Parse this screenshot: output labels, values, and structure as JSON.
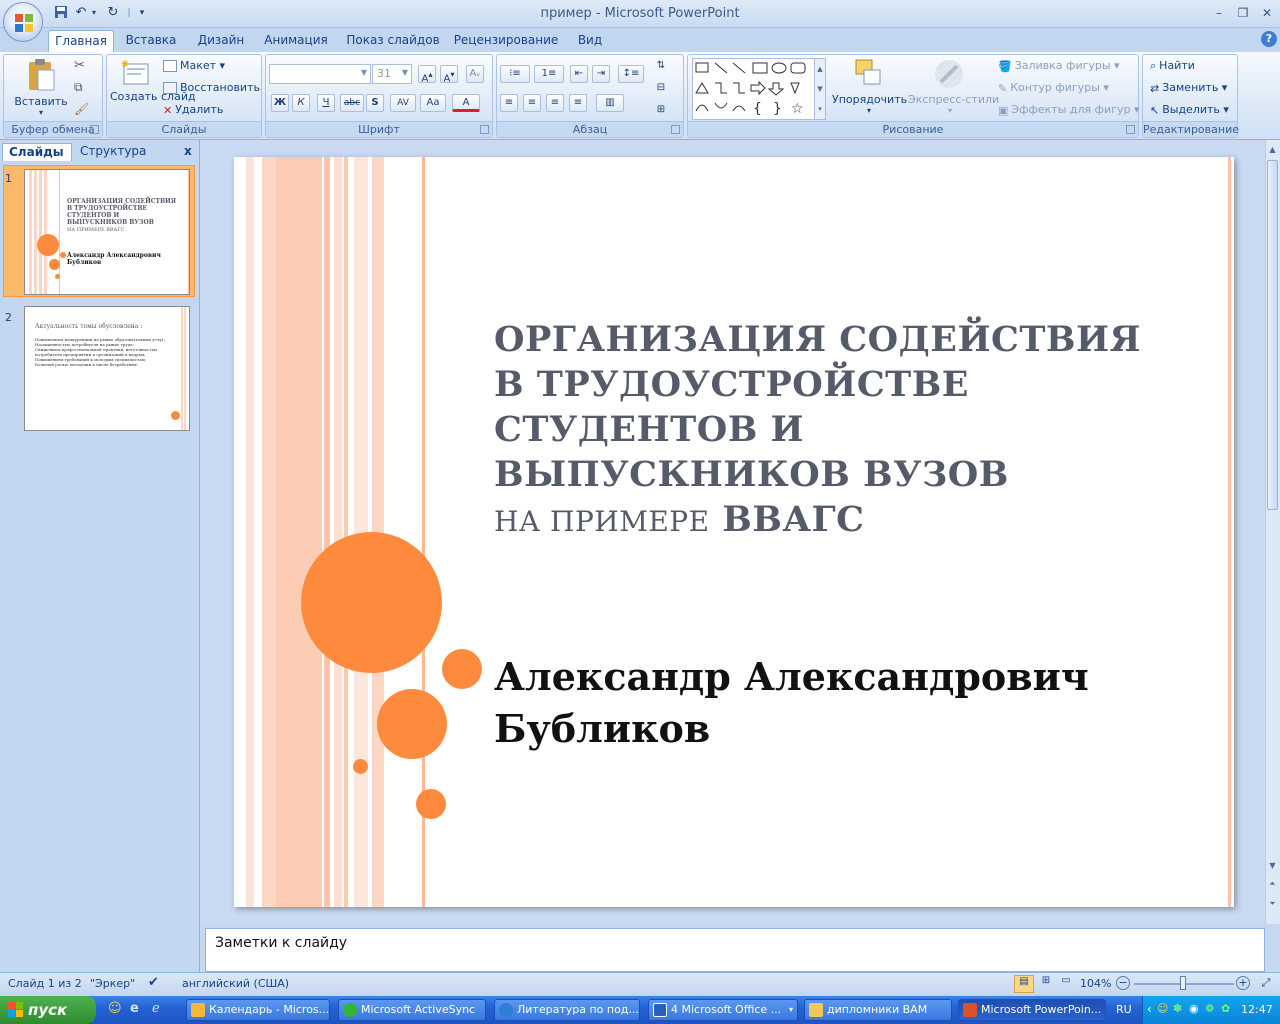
{
  "window": {
    "title": "пример - Microsoft PowerPoint",
    "controls": [
      "–",
      "❐",
      "✕"
    ]
  },
  "tabs": [
    "Главная",
    "Вставка",
    "Дизайн",
    "Анимация",
    "Показ слайдов",
    "Рецензирование",
    "Вид"
  ],
  "active_tab": "Главная",
  "help_label": "?",
  "ribbon": {
    "clipboard": {
      "label": "Буфер обмена",
      "paste": "Вставить"
    },
    "slides": {
      "label": "Слайды",
      "new_slide": "Создать слайд",
      "layout": "Макет",
      "reset": "Восстановить",
      "delete": "Удалить"
    },
    "font": {
      "label": "Шрифт",
      "font_name": "",
      "font_size": "31",
      "bold": "Ж",
      "italic": "К",
      "underline": "Ч",
      "strike": "abc",
      "shadow": "S",
      "spacing": "AV",
      "case": "Aa",
      "color": "A"
    },
    "paragraph": {
      "label": "Абзац"
    },
    "drawing": {
      "label": "Рисование",
      "arrange": "Упорядочить",
      "quick_styles": "Экспресс-стили",
      "fill": "Заливка фигуры",
      "outline": "Контур фигуры",
      "effects": "Эффекты для фигур"
    },
    "editing": {
      "label": "Редактирование",
      "find": "Найти",
      "replace": "Заменить",
      "select": "Выделить"
    }
  },
  "pane": {
    "tab_slides": "Слайды",
    "tab_outline": "Структура",
    "close": "x"
  },
  "thumbnails": [
    {
      "num": "1",
      "title": "ОРГАНИЗАЦИЯ СОДЕЙСТВИЯ В ТРУДОУСТРОЙСТВЕ СТУДЕНТОВ И ВЫПУСКНИКОВ ВУЗОВ",
      "title_small": "НА ПРИМЕРЕ ВВАГС",
      "author": "Александр Александрович Бубликов"
    },
    {
      "num": "2",
      "title": "Актуальность темы обусловлена :",
      "bullets": [
        "Повышением конкуренции на рынке образовательных услуг;",
        "Насыщенностью потребителя на рынке труда;",
        "Снижением профессиональной практики, неготовностью потребителя предприятий и организаций к кадрам;",
        "Повышением требований к молодым специалистам;",
        "Большой ролью молодежи в числе безработных."
      ]
    }
  ],
  "slide": {
    "title_line1": "ОРГАНИЗАЦИЯ СОДЕЙСТВИЯ",
    "title_line2": "В ТРУДОУСТРОЙСТВЕ",
    "title_line3": "СТУДЕНТОВ И",
    "title_line4": "ВЫПУСКНИКОВ ВУЗОВ",
    "title_line5_small": "НА ПРИМЕРЕ",
    "title_line5_big": "ВВАГС",
    "subtitle_line1": "Александр Александрович",
    "subtitle_line2": "Бубликов",
    "accent_color": "#fe8b3d",
    "title_color": "#555b69"
  },
  "notes": {
    "placeholder": "Заметки к слайду"
  },
  "status": {
    "slide_info": "Слайд 1 из 2",
    "theme": "\"Эркер\"",
    "language": "английский (США)",
    "zoom": "104%"
  },
  "taskbar": {
    "start": "пуск",
    "buttons": [
      {
        "label": "Календарь - Micros...",
        "color": "#f5b83b"
      },
      {
        "label": "Microsoft ActiveSync",
        "color": "#36b436"
      },
      {
        "label": "Литература по под...",
        "color": "#2f7fd8"
      },
      {
        "label": "4 Microsoft Office ...",
        "color": "#2b5fc2"
      },
      {
        "label": "дипломники ВАМ",
        "color": "#f0c75a"
      },
      {
        "label": "Microsoft PowerPoin...",
        "color": "#d9532b"
      }
    ],
    "lang": "RU",
    "time": "12:47"
  }
}
